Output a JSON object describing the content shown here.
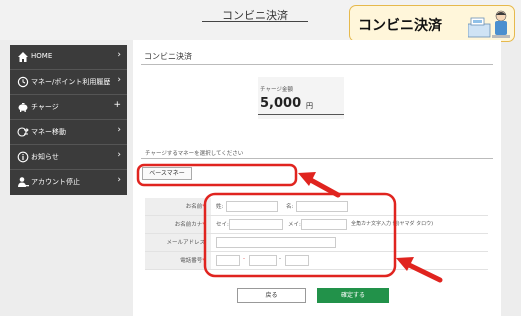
{
  "header": {
    "title": "コンビニ決済"
  },
  "badge": {
    "text": "コンビニ決済"
  },
  "sidebar": {
    "items": [
      {
        "label": "HOME",
        "icon": "home-icon",
        "trail": "›"
      },
      {
        "label": "マネー/ポイント利用履歴",
        "icon": "clock-icon",
        "trail": "›"
      },
      {
        "label": "チャージ",
        "icon": "piggy-bank-icon",
        "trail": "+"
      },
      {
        "label": "マネー移動",
        "icon": "transfer-icon",
        "trail": "›"
      },
      {
        "label": "お知らせ",
        "icon": "info-icon",
        "trail": "›"
      },
      {
        "label": "アカウント停止",
        "icon": "user-stop-icon",
        "trail": "›"
      }
    ]
  },
  "main": {
    "title": "コンビニ決済",
    "amount": {
      "label": "チャージ金額",
      "value": "5,000",
      "unit": "円"
    },
    "select_label": "チャージするマネーを選択してください",
    "money_option": "ベースマネー",
    "form": {
      "name_label": "お名前",
      "sei_label": "姓:",
      "mei_label": "名:",
      "kana_label": "お名前カナ",
      "kana_sei_label": "セイ:",
      "kana_mei_label": "メイ:",
      "kana_hint": "全角カナ文字入力 例)ヤマダ タロウ)",
      "email_label": "メールアドレス",
      "phone_label": "電話番号",
      "phone_sep": "-",
      "required_mark": "*"
    },
    "back_label": "戻る",
    "confirm_label": "確定する"
  },
  "colors": {
    "sidebar_bg": "#3b3b3b",
    "confirm_green": "#22924a",
    "annotation_red": "#e0241f",
    "badge_bg": "#fff6da"
  }
}
